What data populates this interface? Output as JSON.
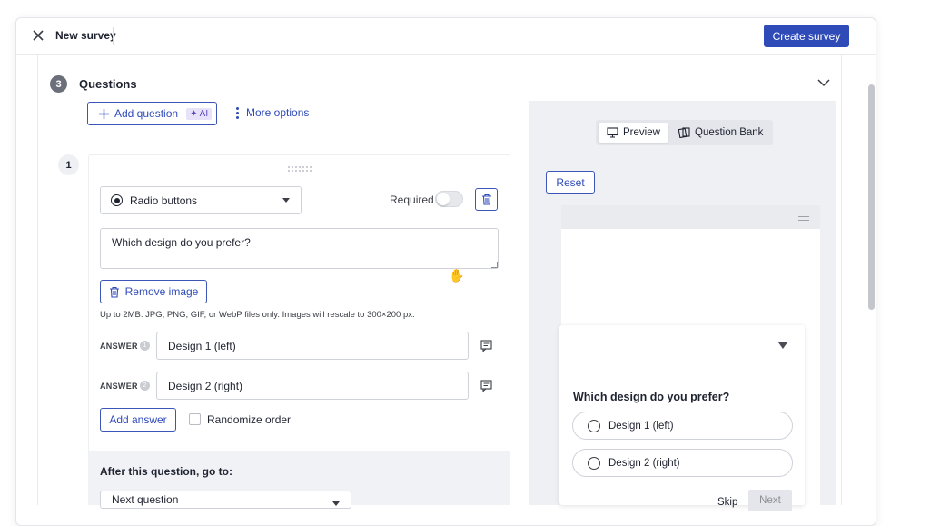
{
  "topbar": {
    "title": "New survey",
    "create_label": "Create survey"
  },
  "section": {
    "number": "3",
    "title": "Questions"
  },
  "toolbar": {
    "add_question_label": "Add question",
    "ai_badge": "✦ AI",
    "more_options_label": "More options"
  },
  "question": {
    "number": "1",
    "type_label": "Radio buttons",
    "required_label": "Required",
    "required": false,
    "text": "Which design do you prefer?",
    "remove_image_label": "Remove image",
    "help_text": "Up to 2MB. JPG, PNG, GIF, or WebP files only. Images will rescale to 300×200 px.",
    "answers": [
      {
        "label": "ANSWER",
        "num": "1",
        "value": "Design 1 (left)"
      },
      {
        "label": "ANSWER",
        "num": "2",
        "value": "Design 2 (right)"
      }
    ],
    "add_answer_label": "Add answer",
    "randomize_label": "Randomize order",
    "after_label": "After this question, go to:",
    "after_value": "Next question"
  },
  "preview": {
    "tabs": [
      {
        "label": "Preview",
        "icon": "monitor-icon",
        "active": true
      },
      {
        "label": "Question Bank",
        "icon": "cards-icon",
        "active": false
      }
    ],
    "reset_label": "Reset",
    "survey": {
      "question": "Which design do you prefer?",
      "options": [
        "Design 1 (left)",
        "Design 2 (right)"
      ],
      "skip_label": "Skip",
      "next_label": "Next"
    }
  },
  "colors": {
    "primary": "#2f4bb8",
    "ai_badge_bg": "#e7e2fa",
    "panel_bg": "#eef0f4"
  }
}
